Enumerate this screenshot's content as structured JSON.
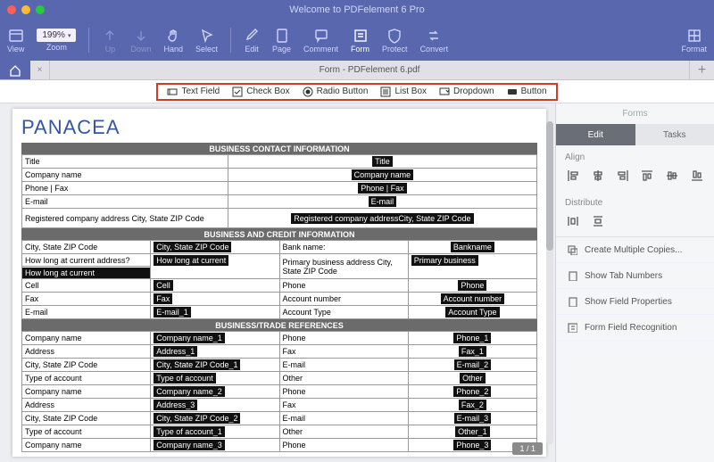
{
  "window": {
    "title": "Welcome to PDFelement 6 Pro"
  },
  "toolbar": {
    "view": "View",
    "zoom": "Zoom",
    "zoom_value": "199%",
    "up": "Up",
    "down": "Down",
    "hand": "Hand",
    "select": "Select",
    "edit": "Edit",
    "page": "Page",
    "comment": "Comment",
    "form": "Form",
    "protect": "Protect",
    "convert": "Convert",
    "format": "Format"
  },
  "tab": {
    "name": "Form - PDFelement 6.pdf"
  },
  "formstrip": {
    "text_field": "Text Field",
    "check_box": "Check Box",
    "radio_button": "Radio Button",
    "list_box": "List Box",
    "dropdown": "Dropdown",
    "button": "Button"
  },
  "doc": {
    "brand": "PANACEA",
    "sec1": "BUSINESS CONTACT INFORMATION",
    "sec2": "BUSINESS AND CREDIT INFORMATION",
    "sec3": "BUSINESS/TRADE REFERENCES",
    "labels": {
      "title": "Title",
      "company": "Company name",
      "phonefax": "Phone | Fax",
      "email": "E-mail",
      "regaddr": "Registered company address\nCity, State ZIP Code",
      "citystate": "City, State ZIP Code",
      "bank": "Bank name:",
      "howlong": "How long at current address?",
      "primaddr": "Primary business address\nCity, State ZIP Code",
      "cell": "Cell",
      "phone": "Phone",
      "fax": "Fax",
      "acctnum": "Account number",
      "accttype": "Account Type",
      "address": "Address",
      "typeacct": "Type of account",
      "other": "Other"
    },
    "fields": {
      "title": "Title",
      "company": "Company name",
      "phonefax": "Phone | Fax",
      "email": "E-mail",
      "regaddr": "Registered company addressCity, State ZIP Code",
      "citystate": "City, State ZIP Code",
      "bankname": "Bankname",
      "howlong": "How long at current",
      "primbiz": "Primary business",
      "cell": "Cell",
      "phone": "Phone",
      "fax": "Fax",
      "acctnum": "Account number",
      "email1": "E-mail_1",
      "accttype": "Account Type",
      "company1": "Company name_1",
      "phone1": "Phone_1",
      "address1": "Address_1",
      "fax1": "Fax_1",
      "csz1": "City, State ZIP Code_1",
      "email2": "E-mail_2",
      "typeacct": "Type of account",
      "other": "Other",
      "company2": "Company name_2",
      "phone2": "Phone_2",
      "address3": "Address_3",
      "fax2": "Fax_2",
      "csz2": "City, State ZIP Code_2",
      "email3": "E-mail_3",
      "typeacct1": "Type of account_1",
      "other1": "Other_1",
      "company3": "Company name_3",
      "phone3": "Phone_3"
    },
    "pagenum": "1 / 1"
  },
  "panel": {
    "title": "Forms",
    "tab_edit": "Edit",
    "tab_tasks": "Tasks",
    "align": "Align",
    "distribute": "Distribute",
    "actions": {
      "copies": "Create Multiple Copies...",
      "tabnums": "Show Tab Numbers",
      "fieldprops": "Show Field Properties",
      "recog": "Form Field Recognition"
    }
  }
}
